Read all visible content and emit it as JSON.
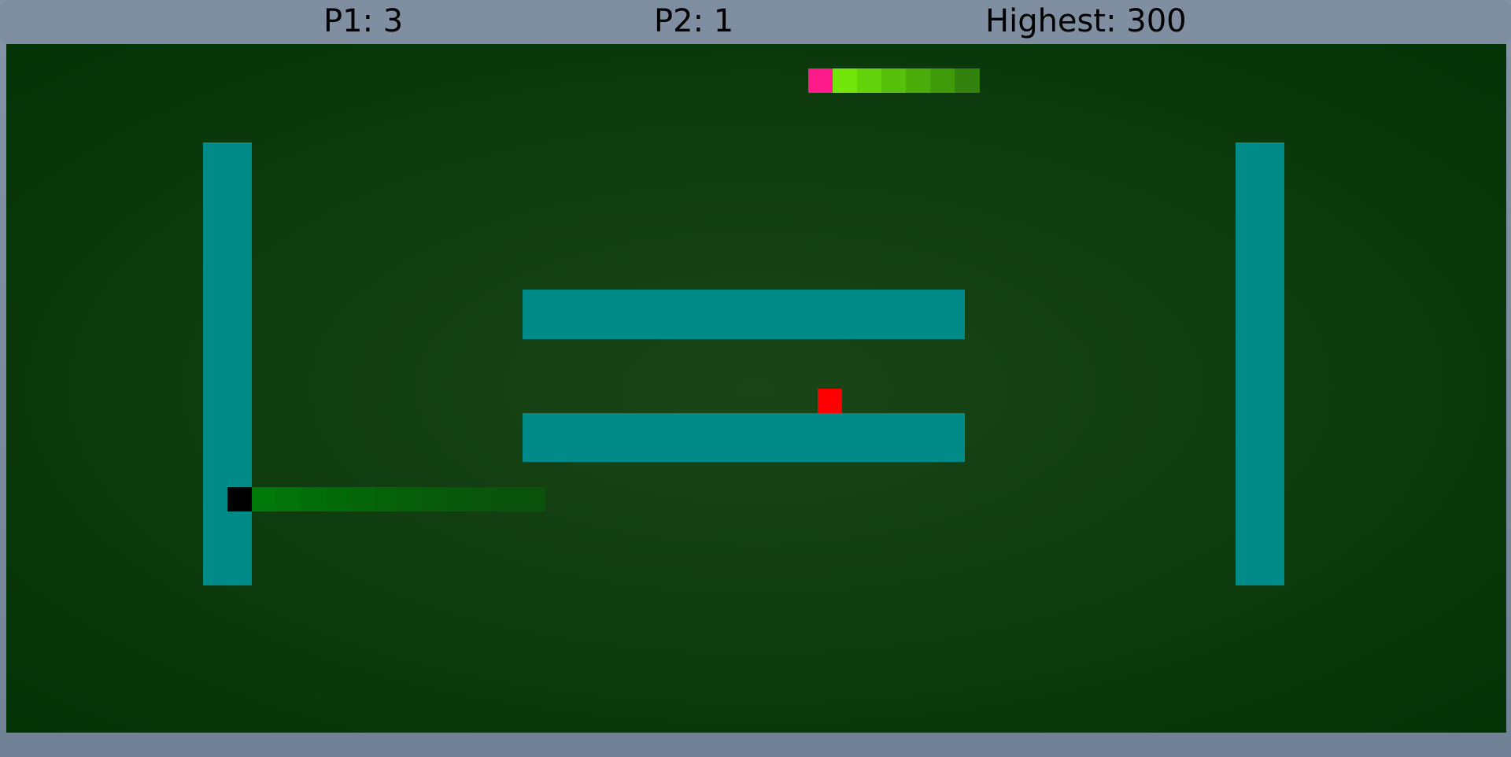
{
  "scoreboard": {
    "p1": "P1: 3",
    "p2": "P2: 1",
    "highest": "Highest: 300"
  },
  "colors": {
    "wall": "#008a88",
    "food": "#ff0000",
    "board_center": "#1a4517",
    "board_edge": "#033306",
    "frame": "#7a8a9c",
    "snake1_head": "#000000",
    "snake1_body": [
      "#00780a",
      "#017309",
      "#026e09",
      "#036a09",
      "#046609",
      "#056209",
      "#065e0a",
      "#075b0b",
      "#08580b",
      "#09550c",
      "#0a530c",
      "#0b520d"
    ],
    "snake2_head": "#ff1a8c",
    "snake2_body": [
      "#72e60a",
      "#63d20a",
      "#56c00a",
      "#4aad0a",
      "#3f9b0a",
      "#33820d"
    ]
  }
}
